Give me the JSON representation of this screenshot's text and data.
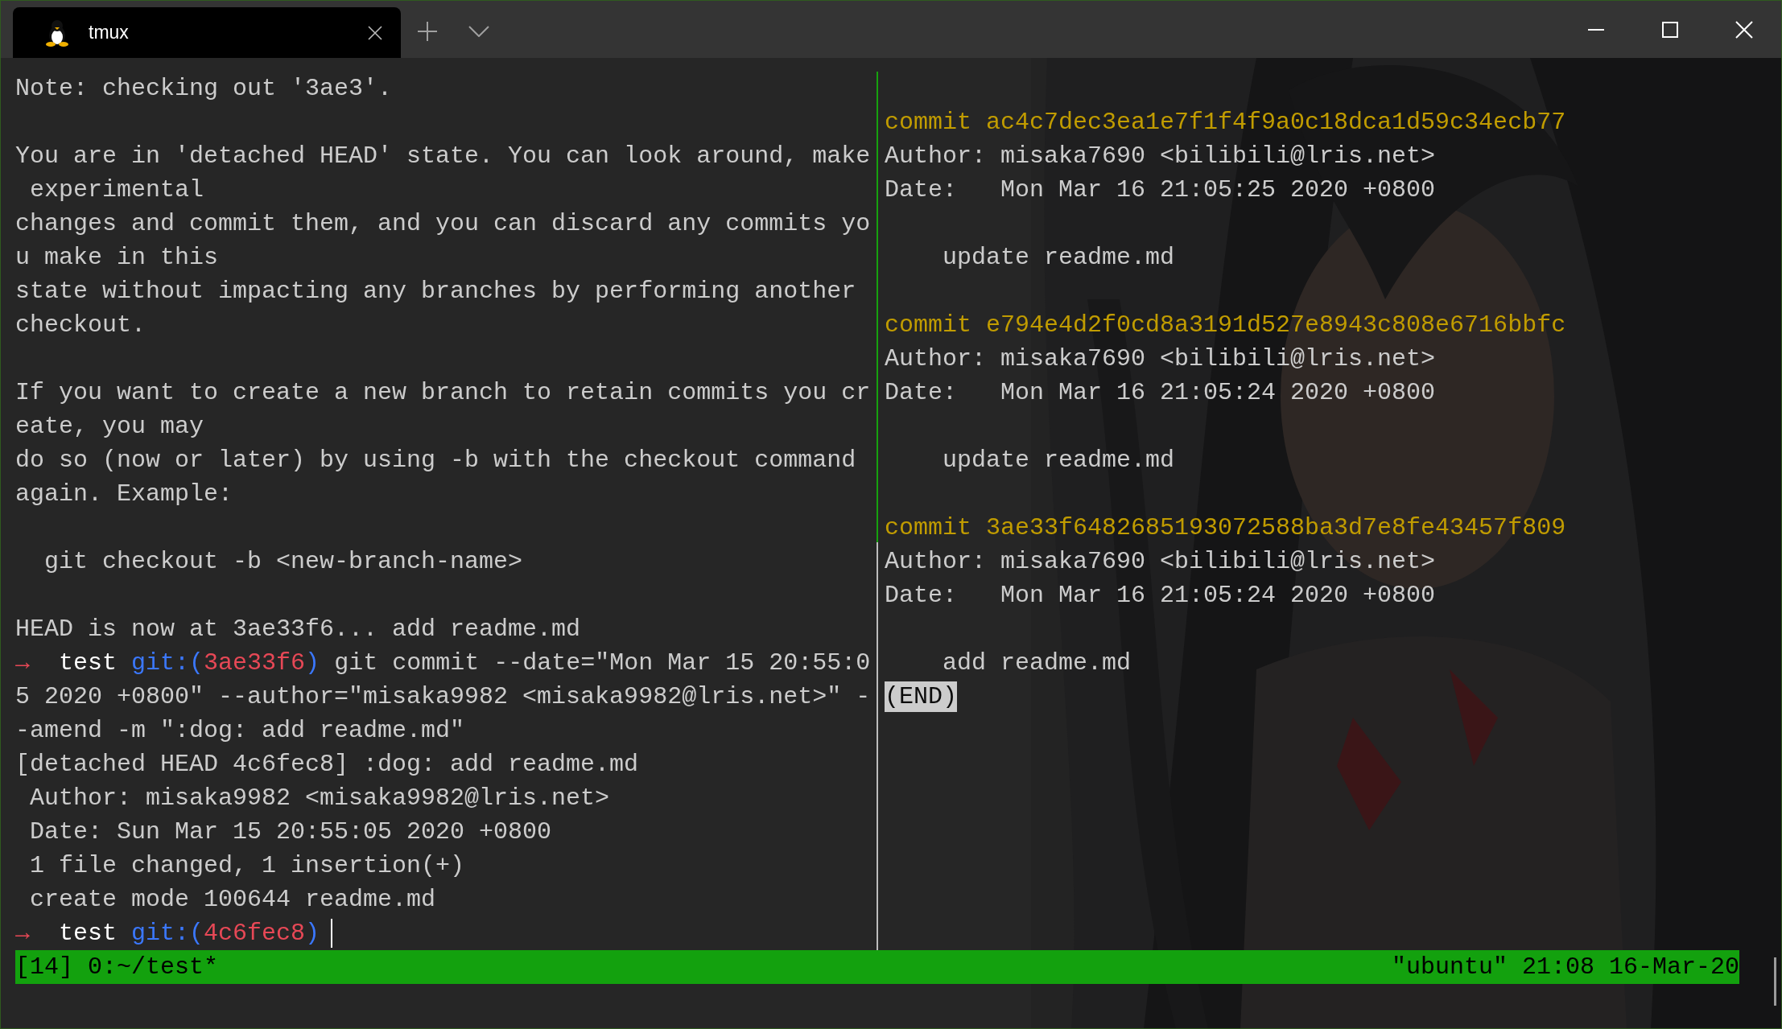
{
  "window": {
    "tabs": [
      {
        "title": "tmux",
        "selected": true
      }
    ]
  },
  "panes": [
    {
      "lines": [
        {
          "kind": "text",
          "text": "Note: checking out '3ae3'."
        },
        {
          "kind": "blank"
        },
        {
          "kind": "text",
          "text": "You are in 'detached HEAD' state. You can look around, make"
        },
        {
          "kind": "text",
          "text": " experimental"
        },
        {
          "kind": "text",
          "text": "changes and commit them, and you can discard any commits yo"
        },
        {
          "kind": "text",
          "text": "u make in this"
        },
        {
          "kind": "text",
          "text": "state without impacting any branches by performing another"
        },
        {
          "kind": "text",
          "text": "checkout."
        },
        {
          "kind": "blank"
        },
        {
          "kind": "text",
          "text": "If you want to create a new branch to retain commits you cr"
        },
        {
          "kind": "text",
          "text": "eate, you may"
        },
        {
          "kind": "text",
          "text": "do so (now or later) by using -b with the checkout command"
        },
        {
          "kind": "text",
          "text": "again. Example:"
        },
        {
          "kind": "blank"
        },
        {
          "kind": "text",
          "text": "  git checkout -b <new-branch-name>"
        },
        {
          "kind": "blank"
        },
        {
          "kind": "text",
          "text": "HEAD is now at 3ae33f6... add readme.md"
        },
        {
          "kind": "prompt",
          "arrow": "→",
          "dir": "test",
          "git": "git:(",
          "hash": "3ae33f6",
          "close": ")",
          "command": " git commit --date=\"Mon Mar 15 20:55:0"
        },
        {
          "kind": "text",
          "text": "5 2020 +0800\" --author=\"misaka9982 <misaka9982@lris.net>\" -"
        },
        {
          "kind": "text",
          "text": "-amend -m \":dog: add readme.md\""
        },
        {
          "kind": "text",
          "text": "[detached HEAD 4c6fec8] :dog: add readme.md"
        },
        {
          "kind": "text",
          "text": " Author: misaka9982 <misaka9982@lris.net>"
        },
        {
          "kind": "text",
          "text": " Date: Sun Mar 15 20:55:05 2020 +0800"
        },
        {
          "kind": "text",
          "text": " 1 file changed, 1 insertion(+)"
        },
        {
          "kind": "text",
          "text": " create mode 100644 readme.md"
        },
        {
          "kind": "prompt",
          "arrow": "→",
          "dir": "test",
          "git": "git:(",
          "hash": "4c6fec8",
          "close": ")",
          "cursor": true
        }
      ]
    },
    {
      "lines": [
        {
          "kind": "blank"
        },
        {
          "kind": "commit",
          "text": "commit ac4c7dec3ea1e7f1f4f9a0c18dca1d59c34ecb77"
        },
        {
          "kind": "text",
          "text": "Author: misaka7690 <bilibili@lris.net>"
        },
        {
          "kind": "text",
          "text": "Date:   Mon Mar 16 21:05:25 2020 +0800"
        },
        {
          "kind": "blank"
        },
        {
          "kind": "text",
          "text": "    update readme.md"
        },
        {
          "kind": "blank"
        },
        {
          "kind": "commit",
          "text": "commit e794e4d2f0cd8a3191d527e8943c808e6716bbfc"
        },
        {
          "kind": "text",
          "text": "Author: misaka7690 <bilibili@lris.net>"
        },
        {
          "kind": "text",
          "text": "Date:   Mon Mar 16 21:05:24 2020 +0800"
        },
        {
          "kind": "blank"
        },
        {
          "kind": "text",
          "text": "    update readme.md"
        },
        {
          "kind": "blank"
        },
        {
          "kind": "commit",
          "text": "commit 3ae33f6482685193072588ba3d7e8fe43457f809"
        },
        {
          "kind": "text",
          "text": "Author: misaka7690 <bilibili@lris.net>"
        },
        {
          "kind": "text",
          "text": "Date:   Mon Mar 16 21:05:24 2020 +0800"
        },
        {
          "kind": "blank"
        },
        {
          "kind": "text",
          "text": "    add readme.md"
        },
        {
          "kind": "end",
          "text": "(END)"
        }
      ]
    }
  ],
  "status_bar": {
    "left": "[14] 0:~/test*",
    "right": "\"ubuntu\" 21:08 16-Mar-20"
  }
}
